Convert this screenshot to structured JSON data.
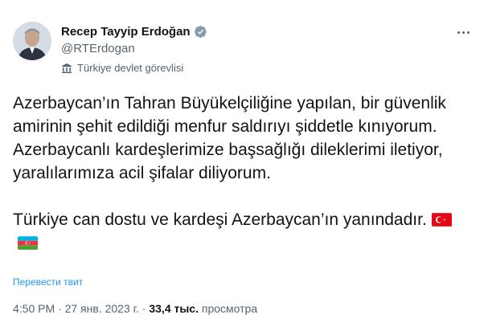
{
  "author": {
    "name": "Recep Tayyip Erdoğan",
    "handle": "@RTErdogan",
    "affiliation": "Türkiye devlet görevlisi"
  },
  "tweet": {
    "paragraph1": "Azerbaycan’ın Tahran Büyükelçiliğine yapılan, bir güvenlik amirinin şehit edildiği menfur saldırıyı şiddetle kınıyorum. Azerbaycanlı kardeşlerimize başsağlığı dileklerimi iletiyor, yaralılarımıza acil şifalar diliyorum.",
    "paragraph2": "Türkiye can dostu ve kardeşi Azerbaycan’ın yanındadır."
  },
  "translate_label": "Перевести твит",
  "meta": {
    "time": "4:50 PM",
    "separator": " · ",
    "date": "27 янв. 2023 г.",
    "views_count": "33,4 тыс.",
    "views_label": "просмотра"
  },
  "colors": {
    "link": "#1d9bf0",
    "verified": "#829aab",
    "secondary_text": "#536471"
  },
  "icons": [
    "verified-badge-icon",
    "more-options-icon",
    "government-building-icon",
    "turkey-flag-icon",
    "azerbaijan-flag-icon"
  ]
}
